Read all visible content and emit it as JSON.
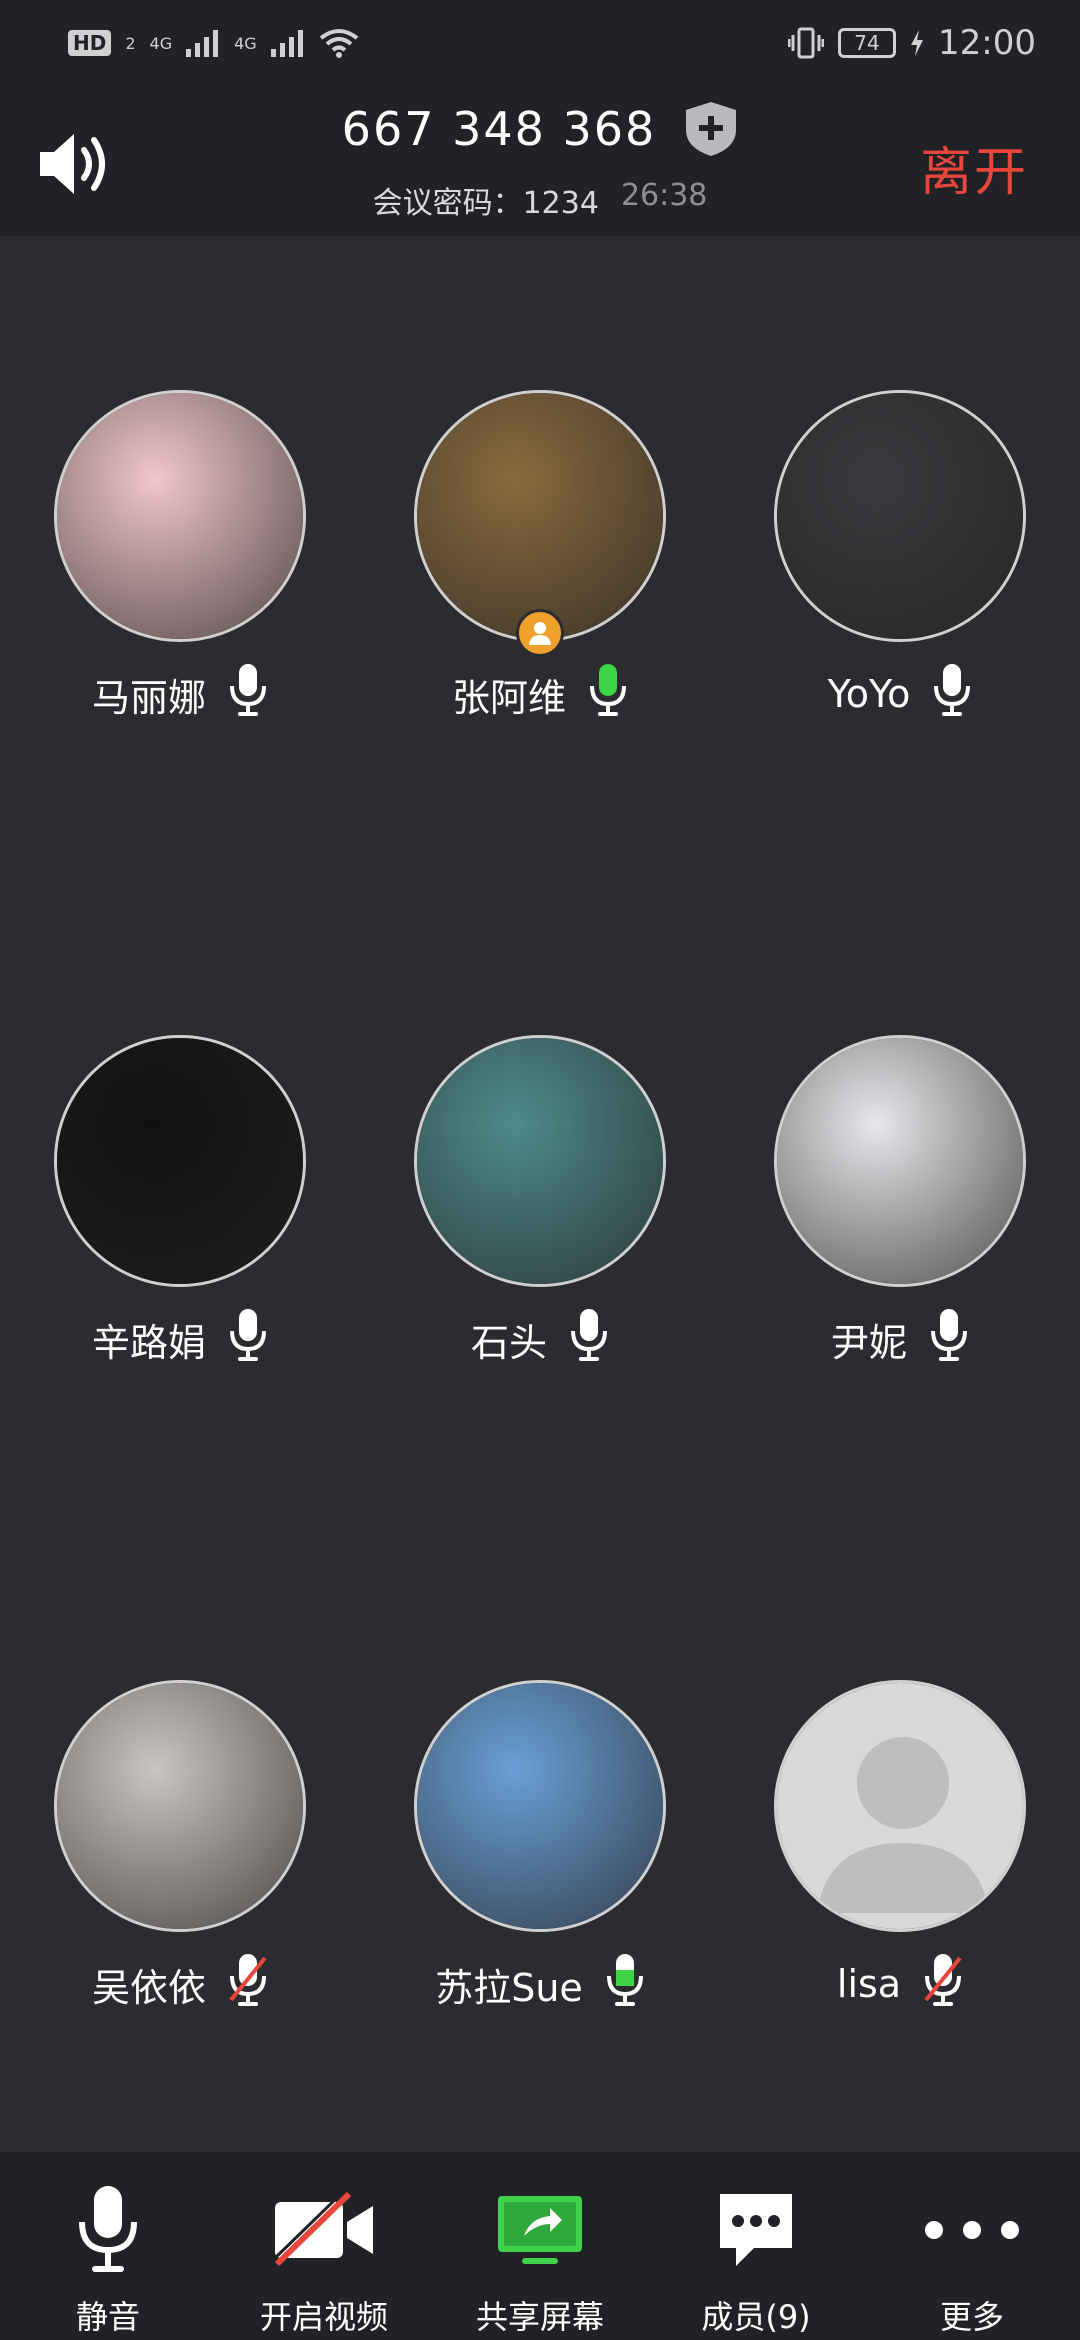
{
  "status_bar": {
    "hd_label": "HD",
    "sim_slot": "2",
    "network_1": "4G",
    "network_2": "4G",
    "battery_level": "74",
    "time": "12:00"
  },
  "header": {
    "meeting_id": "667 348 368",
    "password_label": "会议密码：1234",
    "duration": "26:38",
    "leave_label": "离开"
  },
  "participants": [
    {
      "name": "马丽娜",
      "mic": "idle",
      "avatar_color": "#f1c6c9"
    },
    {
      "name": "张阿维",
      "mic": "active",
      "avatar_color": "#8a6a3e",
      "host": true
    },
    {
      "name": "YoYo",
      "mic": "idle",
      "avatar_color": "#3a3a3e"
    },
    {
      "name": "辛路娟",
      "mic": "idle",
      "avatar_color": "#111111"
    },
    {
      "name": "石头",
      "mic": "idle",
      "avatar_color": "#4f8a8b"
    },
    {
      "name": "尹妮",
      "mic": "idle",
      "avatar_color": "#e6e7ea"
    },
    {
      "name": "吴依依",
      "mic": "muted",
      "avatar_color": "#cbc5c1"
    },
    {
      "name": "苏拉Sue",
      "mic": "low",
      "avatar_color": "#6a9fd6"
    },
    {
      "name": "lisa",
      "mic": "muted",
      "avatar_color": "#d9d9d9",
      "placeholder": true
    }
  ],
  "toolbar": {
    "mute_label": "静音",
    "video_label": "开启视频",
    "share_label": "共享屏幕",
    "members_label": "成员(9)",
    "more_label": "更多"
  },
  "colors": {
    "accent_green": "#3fd34a",
    "leave_red": "#e8453c",
    "host_orange": "#f0a02c",
    "background": "#2b2c30"
  }
}
